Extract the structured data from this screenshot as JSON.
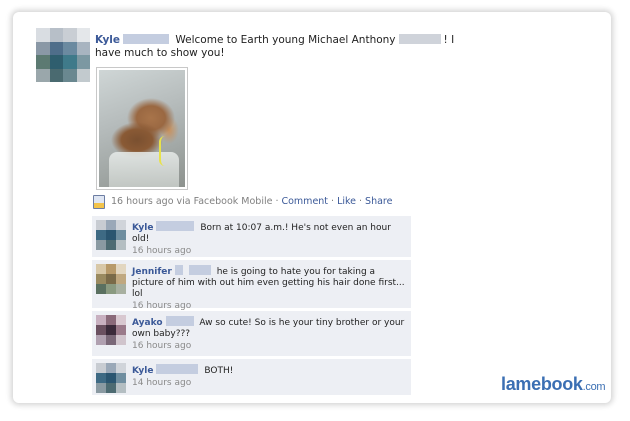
{
  "post": {
    "author": "Kyle",
    "text_before": "Welcome to Earth young Michael Anthony",
    "text_after": "! I have much to show you!",
    "meta": {
      "time": "16 hours ago",
      "via": "via Facebook Mobile",
      "sep": "·",
      "comment_link": "Comment",
      "like_link": "Like",
      "share_link": "Share"
    }
  },
  "comments": [
    {
      "author": "Kyle",
      "text": "Born at 10:07 a.m.! He's not even an hour old!",
      "time": "16 hours ago"
    },
    {
      "author": "Jennifer",
      "text": "he is going to hate you for taking a picture of him with out him even getting his hair done first... lol",
      "time": "16 hours ago"
    },
    {
      "author": "Ayako",
      "text": "Aw so cute! So is he your tiny brother or your own baby???",
      "time": "16 hours ago"
    },
    {
      "author": "Kyle",
      "text": "BOTH!",
      "time": "14 hours ago"
    }
  ],
  "watermark": {
    "brand": "lamebook",
    "suffix": ".com"
  },
  "colors": {
    "link": "#3b5998",
    "comment_bg": "#edeff4",
    "watermark": "#3b6fb3"
  }
}
